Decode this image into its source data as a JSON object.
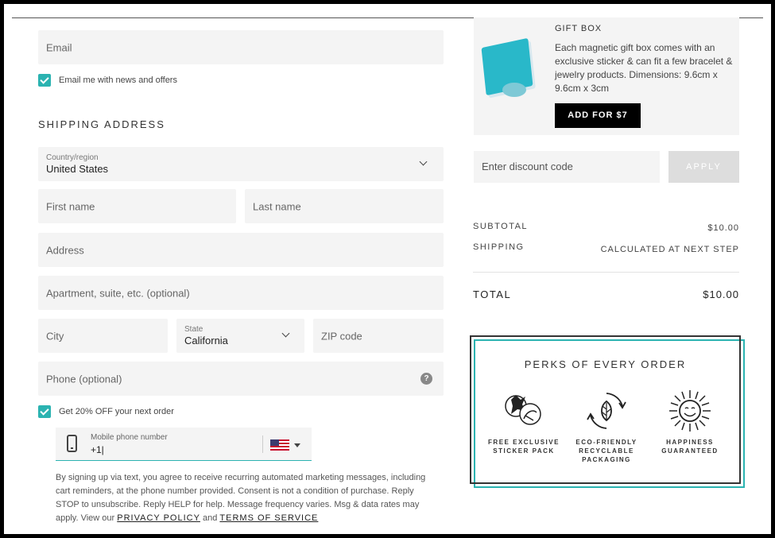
{
  "contact": {
    "email_placeholder": "Email",
    "email_news_label": "Email me with news and offers",
    "email_news_checked": true
  },
  "shipping": {
    "title": "SHIPPING ADDRESS",
    "country_label": "Country/region",
    "country_value": "United States",
    "first_name_placeholder": "First name",
    "last_name_placeholder": "Last name",
    "address_placeholder": "Address",
    "apartment_placeholder": "Apartment, suite, etc. (optional)",
    "city_placeholder": "City",
    "state_label": "State",
    "state_value": "California",
    "zip_placeholder": "ZIP code",
    "phone_placeholder": "Phone (optional)",
    "help_icon_text": "?"
  },
  "sms": {
    "offer_label": "Get 20% OFF your next order",
    "offer_checked": true,
    "mobile_label": "Mobile phone number",
    "mobile_value": "+1|",
    "country_flag": "us-flag-icon",
    "disclaimer_text": "By signing up via text, you agree to receive recurring automated marketing messages, including cart reminders, at the phone number provided. Consent is not a condition of purchase. Reply STOP to unsubscribe. Reply HELP for help. Message frequency varies. Msg & data rates may apply. View our ",
    "privacy_link": "PRIVACY POLICY",
    "and_text": " and ",
    "terms_link": "TERMS OF SERVICE"
  },
  "upsell": {
    "title": "GIFT BOX",
    "description": "Each magnetic gift box comes with an exclusive sticker & can fit a few bracelet & jewelry products. Dimensions: 9.6cm x 9.6cm x 3cm",
    "add_button": "ADD FOR $7"
  },
  "discount": {
    "placeholder": "Enter discount code",
    "apply_button": "APPLY"
  },
  "summary": {
    "subtotal_label": "SUBTOTAL",
    "subtotal_value": "$10.00",
    "shipping_label": "SHIPPING",
    "shipping_value": "CALCULATED AT NEXT STEP",
    "total_label": "TOTAL",
    "total_value": "$10.00"
  },
  "perks": {
    "title": "PERKS OF EVERY ORDER",
    "items": [
      {
        "label": "FREE EXCLUSIVE STICKER PACK",
        "icon": "sticker-icon"
      },
      {
        "label": "ECO-FRIENDLY RECYCLABLE PACKAGING",
        "icon": "recycle-icon"
      },
      {
        "label": "HAPPINESS GUARANTEED",
        "icon": "sun-icon"
      }
    ]
  },
  "colors": {
    "accent": "#2bb3b1",
    "field_bg": "#f4f4f4",
    "button_dark": "#000000",
    "button_disabled": "#dddddd"
  }
}
